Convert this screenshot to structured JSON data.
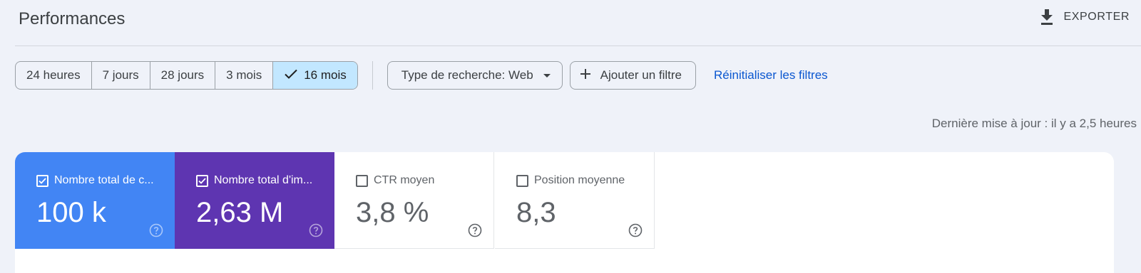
{
  "header": {
    "title": "Performances",
    "export_label": "EXPORTER"
  },
  "date_range": {
    "options": [
      "24 heures",
      "7 jours",
      "28 jours",
      "3 mois",
      "16 mois"
    ],
    "selected": "16 mois"
  },
  "filters": {
    "search_type_label": "Type de recherche: Web",
    "add_filter_label": "Ajouter un filtre",
    "reset_label": "Réinitialiser les filtres"
  },
  "last_update": "Dernière mise à jour : il y a 2,5 heures",
  "metrics": [
    {
      "label": "Nombre total de c...",
      "value": "100 k",
      "checked": true,
      "color": "#4285f4"
    },
    {
      "label": "Nombre total d'im...",
      "value": "2,63 M",
      "checked": true,
      "color": "#5e35b1"
    },
    {
      "label": "CTR moyen",
      "value": "3,8 %",
      "checked": false,
      "color": "#ffffff"
    },
    {
      "label": "Position moyenne",
      "value": "8,3",
      "checked": false,
      "color": "#ffffff"
    }
  ],
  "icons": {
    "export": "download-icon",
    "selected": "check-icon",
    "dropdown": "caret-down-icon",
    "add": "plus-icon",
    "help": "help-circle-icon"
  },
  "colors": {
    "background": "#eff2f9",
    "selected_segment": "#c2e7ff",
    "link": "#0b57d0",
    "clicks": "#4285f4",
    "impressions": "#5e35b1"
  }
}
